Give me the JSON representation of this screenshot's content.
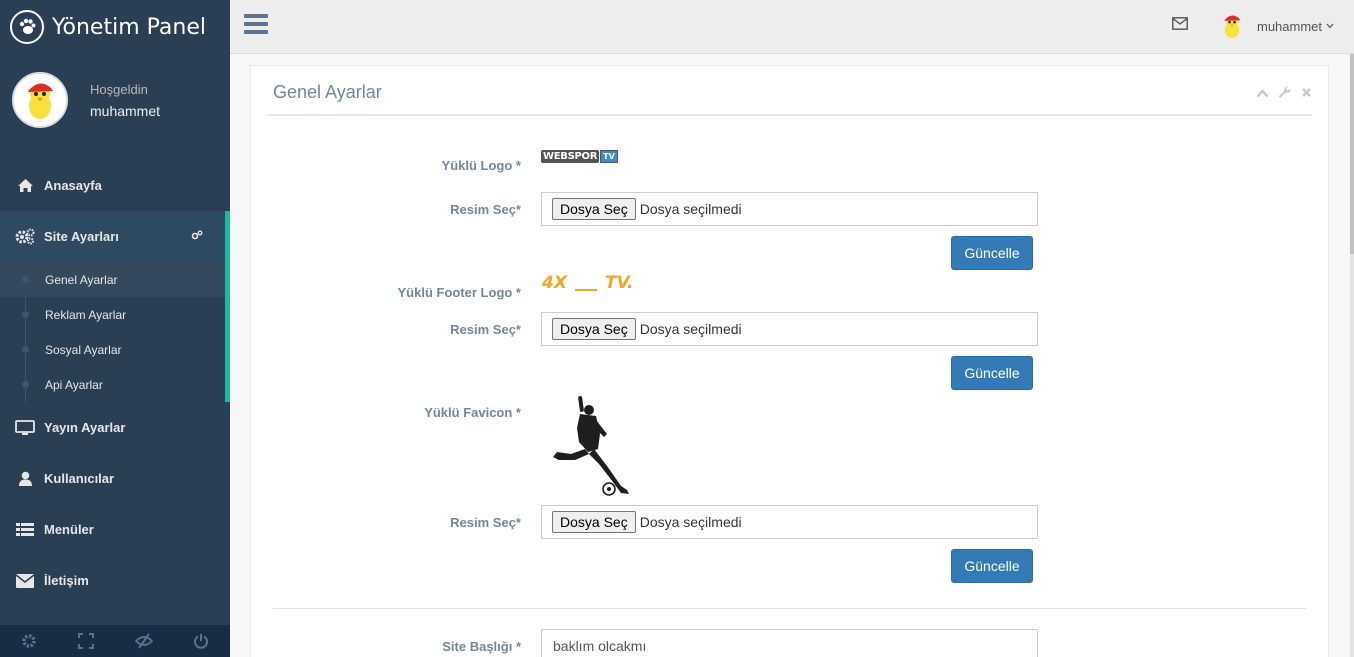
{
  "brand": {
    "title": "Yönetim Panel",
    "icon": "paw-icon"
  },
  "profile": {
    "welcome": "Hoşgeldin",
    "name": "muhammet"
  },
  "menu": {
    "items": [
      {
        "label": "Anasayfa",
        "icon": "home-icon"
      },
      {
        "label": "Site Ayarları",
        "icon": "gears-icon"
      },
      {
        "label": "Yayın Ayarlar",
        "icon": "desktop-icon"
      },
      {
        "label": "Kullanıcılar",
        "icon": "user-icon"
      },
      {
        "label": "Menüler",
        "icon": "list-icon"
      },
      {
        "label": "İletişim",
        "icon": "envelope-icon"
      }
    ],
    "submenu": [
      {
        "label": "Genel Ayarlar"
      },
      {
        "label": "Reklam Ayarlar"
      },
      {
        "label": "Sosyal Ayarlar"
      },
      {
        "label": "Api Ayarlar"
      }
    ]
  },
  "footer_icons": [
    "settings-icon",
    "fullscreen-icon",
    "eye-slash-icon",
    "power-icon"
  ],
  "topnav": {
    "user": "muhammet"
  },
  "panel": {
    "title": "Genel Ayarlar",
    "logo_label": "Yüklü Logo *",
    "logo_text": "WEBSPOR",
    "logo_badge": "TV",
    "footer_logo_label": "Yüklü Footer Logo *",
    "footer_logo_left": "4X",
    "footer_logo_right": "TV.",
    "favicon_label": "Yüklü Favicon *",
    "file_label": "Resim Seç*",
    "file_button": "Dosya Seç",
    "file_status": "Dosya seçilmedi",
    "update_button": "Güncelle",
    "site_title_label": "Site Başlığı *",
    "site_title_value": "baklım olcakmı"
  },
  "colors": {
    "sidebar": "#2A3F54",
    "accent": "#1ABB9C",
    "primary": "#337AB7",
    "topbar": "#EDEDED"
  }
}
